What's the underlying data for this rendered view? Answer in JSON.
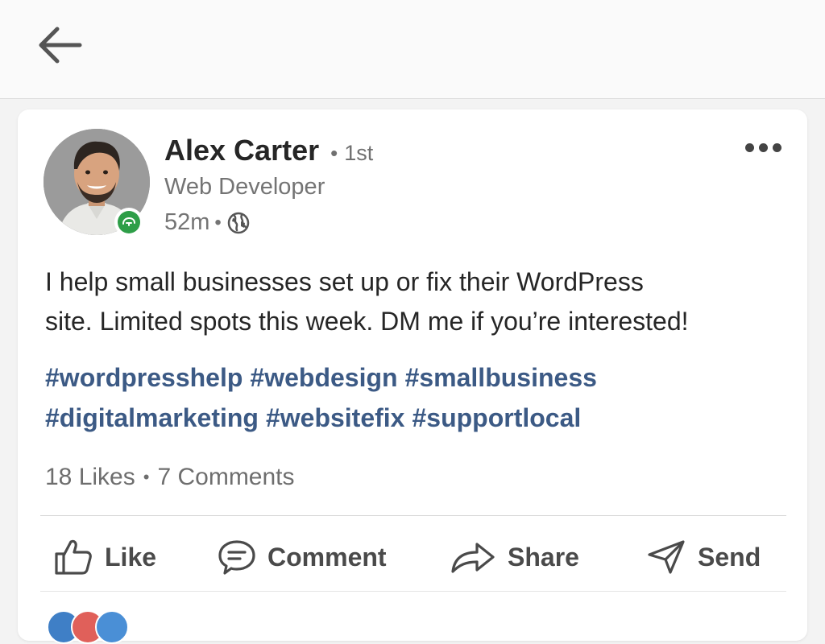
{
  "header": {
    "back_icon": "arrow-left-icon"
  },
  "post": {
    "author": {
      "name": "Alex Carter",
      "degree": "1st",
      "headline": "Web Developer",
      "presence_icon": "green-status-badge-icon"
    },
    "meta": {
      "time": "52m",
      "visibility_icon": "globe-icon"
    },
    "more_icon": "more-horizontal-icon",
    "body_lines": [
      "I help small businesses set up or fix their WordPress",
      "site. Limited spots this week. DM me if you’re interested!"
    ],
    "hashtag_lines": [
      [
        "#wordpresshelp",
        "#webdesign",
        "#smallbusiness"
      ],
      [
        "#digitalmarketing",
        "#websitefix",
        "#supportlocal"
      ]
    ],
    "counts": {
      "likes": "18 Likes",
      "comments": "7 Comments"
    },
    "actions": [
      {
        "label": "Like",
        "icon": "thumbs-up-icon"
      },
      {
        "label": "Comment",
        "icon": "comment-icon"
      },
      {
        "label": "Share",
        "icon": "share-arrow-icon"
      },
      {
        "label": "Send",
        "icon": "send-icon"
      }
    ]
  },
  "colors": {
    "hashtag": "#3c5a85",
    "presence": "#2e9e48",
    "reaction_blue": "#3f7fc6",
    "reaction_red": "#e0605a",
    "reaction_blue2": "#4a8fd6"
  }
}
